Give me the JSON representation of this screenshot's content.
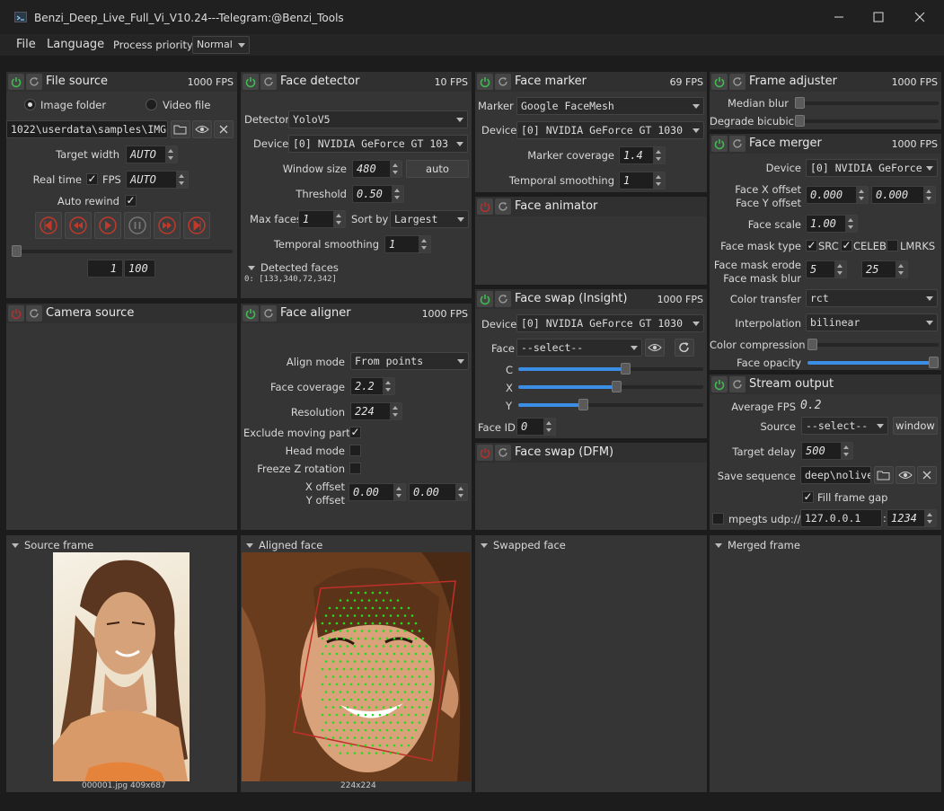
{
  "window": {
    "title": "Benzi_Deep_Live_Full_Vi_V10.24---Telegram:@Benzi_Tools"
  },
  "menu": {
    "file": "File",
    "language": "Language",
    "priority_label": "Process priority",
    "priority_value": "Normal"
  },
  "file_source": {
    "title": "File source",
    "fps": "1000 FPS",
    "image_folder": "Image folder",
    "video_file": "Video file",
    "path": "1022\\userdata\\samples\\IMG",
    "target_width_label": "Target width",
    "target_width": "AUTO",
    "real_time_label": "Real time",
    "fps_label": "FPS",
    "fps_value": "AUTO",
    "auto_rewind_label": "Auto rewind",
    "frame_index": "1",
    "frame_sep": "/",
    "frame_total": "100"
  },
  "camera_source": {
    "title": "Camera source"
  },
  "face_detector": {
    "title": "Face detector",
    "fps": "10 FPS",
    "detector_label": "Detector",
    "detector": "YoloV5",
    "device_label": "Device",
    "device": "[0] NVIDIA GeForce GT 103",
    "window_size_label": "Window size",
    "window_size": "480",
    "auto": "auto",
    "threshold_label": "Threshold",
    "threshold": "0.50",
    "max_faces_label": "Max faces",
    "max_faces": "1",
    "sort_by_label": "Sort by",
    "sort_by": "Largest",
    "temporal_label": "Temporal smoothing",
    "temporal": "1",
    "detected_label": "Detected faces",
    "detected_item": "0: [133,340,72,342]"
  },
  "face_aligner": {
    "title": "Face aligner",
    "fps": "1000 FPS",
    "align_mode_label": "Align mode",
    "align_mode": "From points",
    "coverage_label": "Face coverage",
    "coverage": "2.2",
    "resolution_label": "Resolution",
    "resolution": "224",
    "exclude_label": "Exclude moving parts",
    "head_mode_label": "Head mode",
    "freeze_label": "Freeze Z rotation",
    "xoffset_label": "X offset",
    "yoffset_label": "Y offset",
    "xoffset": "0.00",
    "yoffset": "0.00"
  },
  "face_marker": {
    "title": "Face marker",
    "fps": "69 FPS",
    "marker_label": "Marker",
    "marker": "Google FaceMesh",
    "device_label": "Device",
    "device": "[0] NVIDIA GeForce GT 1030",
    "coverage_label": "Marker coverage",
    "coverage": "1.4",
    "temporal_label": "Temporal smoothing",
    "temporal": "1"
  },
  "face_animator": {
    "title": "Face animator"
  },
  "face_swap_insight": {
    "title": "Face swap (Insight)",
    "fps": "1000 FPS",
    "device_label": "Device",
    "device": "[0] NVIDIA GeForce GT 1030",
    "face_label": "Face",
    "face": "--select--",
    "c_label": "C",
    "x_label": "X",
    "y_label": "Y",
    "c_value": 0.58,
    "x_value": 0.53,
    "y_value": 0.35,
    "face_id_label": "Face ID",
    "face_id": "0"
  },
  "face_swap_dfm": {
    "title": "Face swap (DFM)"
  },
  "frame_adjuster": {
    "title": "Frame adjuster",
    "fps": "1000 FPS",
    "median_label": "Median blur",
    "degrade_label": "Degrade bicubic"
  },
  "face_merger": {
    "title": "Face merger",
    "fps": "1000 FPS",
    "device_label": "Device",
    "device": "[0] NVIDIA GeForce",
    "fx_label": "Face X offset",
    "fy_label": "Face Y offset",
    "fx": "0.000",
    "fy": "0.000",
    "scale_label": "Face scale",
    "scale": "1.00",
    "mask_type_label": "Face mask type",
    "src": "SRC",
    "celeb": "CELEB",
    "lmrks": "LMRKS",
    "erode_label": "Face mask erode",
    "blur_label": "Face mask blur",
    "erode": "5",
    "blur": "25",
    "color_transfer_label": "Color transfer",
    "color_transfer": "rct",
    "interp_label": "Interpolation",
    "interp": "bilinear",
    "compression_label": "Color compression",
    "opacity_label": "Face opacity",
    "opacity_value": 1.0
  },
  "stream_output": {
    "title": "Stream output",
    "avg_fps_label": "Average FPS",
    "avg_fps": "0.2",
    "source_label": "Source",
    "source": "--select--",
    "window": "window",
    "delay_label": "Target delay",
    "delay": "500",
    "save_label": "Save sequence",
    "save_path": "deep\\nolive",
    "fill_gap_label": "Fill frame gap",
    "mpegts_label": "mpegts udp://",
    "ip": "127.0.0.1",
    "port": "1234"
  },
  "views": {
    "source_frame": "Source frame",
    "source_caption": "000001.jpg 409x687",
    "aligned_face": "Aligned face",
    "aligned_caption": "224x224",
    "swapped_face": "Swapped face",
    "merged_frame": "Merged frame"
  },
  "colors": {
    "accent": "#3a8ee6",
    "power_on": "#3fb950",
    "power_off": "#b03030"
  }
}
